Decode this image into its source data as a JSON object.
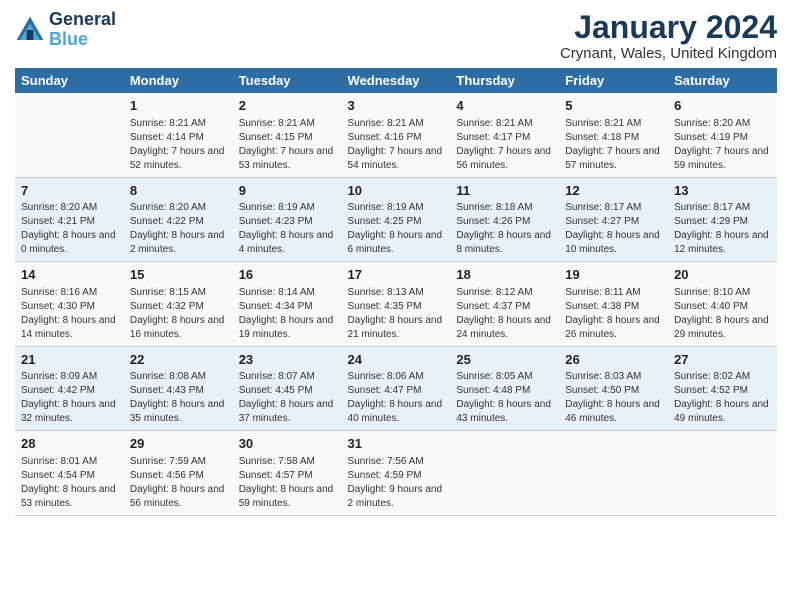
{
  "logo": {
    "line1": "General",
    "line2": "Blue"
  },
  "title": "January 2024",
  "location": "Crynant, Wales, United Kingdom",
  "days_of_week": [
    "Sunday",
    "Monday",
    "Tuesday",
    "Wednesday",
    "Thursday",
    "Friday",
    "Saturday"
  ],
  "weeks": [
    [
      {
        "num": "",
        "sunrise": "",
        "sunset": "",
        "daylight": ""
      },
      {
        "num": "1",
        "sunrise": "Sunrise: 8:21 AM",
        "sunset": "Sunset: 4:14 PM",
        "daylight": "Daylight: 7 hours and 52 minutes."
      },
      {
        "num": "2",
        "sunrise": "Sunrise: 8:21 AM",
        "sunset": "Sunset: 4:15 PM",
        "daylight": "Daylight: 7 hours and 53 minutes."
      },
      {
        "num": "3",
        "sunrise": "Sunrise: 8:21 AM",
        "sunset": "Sunset: 4:16 PM",
        "daylight": "Daylight: 7 hours and 54 minutes."
      },
      {
        "num": "4",
        "sunrise": "Sunrise: 8:21 AM",
        "sunset": "Sunset: 4:17 PM",
        "daylight": "Daylight: 7 hours and 56 minutes."
      },
      {
        "num": "5",
        "sunrise": "Sunrise: 8:21 AM",
        "sunset": "Sunset: 4:18 PM",
        "daylight": "Daylight: 7 hours and 57 minutes."
      },
      {
        "num": "6",
        "sunrise": "Sunrise: 8:20 AM",
        "sunset": "Sunset: 4:19 PM",
        "daylight": "Daylight: 7 hours and 59 minutes."
      }
    ],
    [
      {
        "num": "7",
        "sunrise": "Sunrise: 8:20 AM",
        "sunset": "Sunset: 4:21 PM",
        "daylight": "Daylight: 8 hours and 0 minutes."
      },
      {
        "num": "8",
        "sunrise": "Sunrise: 8:20 AM",
        "sunset": "Sunset: 4:22 PM",
        "daylight": "Daylight: 8 hours and 2 minutes."
      },
      {
        "num": "9",
        "sunrise": "Sunrise: 8:19 AM",
        "sunset": "Sunset: 4:23 PM",
        "daylight": "Daylight: 8 hours and 4 minutes."
      },
      {
        "num": "10",
        "sunrise": "Sunrise: 8:19 AM",
        "sunset": "Sunset: 4:25 PM",
        "daylight": "Daylight: 8 hours and 6 minutes."
      },
      {
        "num": "11",
        "sunrise": "Sunrise: 8:18 AM",
        "sunset": "Sunset: 4:26 PM",
        "daylight": "Daylight: 8 hours and 8 minutes."
      },
      {
        "num": "12",
        "sunrise": "Sunrise: 8:17 AM",
        "sunset": "Sunset: 4:27 PM",
        "daylight": "Daylight: 8 hours and 10 minutes."
      },
      {
        "num": "13",
        "sunrise": "Sunrise: 8:17 AM",
        "sunset": "Sunset: 4:29 PM",
        "daylight": "Daylight: 8 hours and 12 minutes."
      }
    ],
    [
      {
        "num": "14",
        "sunrise": "Sunrise: 8:16 AM",
        "sunset": "Sunset: 4:30 PM",
        "daylight": "Daylight: 8 hours and 14 minutes."
      },
      {
        "num": "15",
        "sunrise": "Sunrise: 8:15 AM",
        "sunset": "Sunset: 4:32 PM",
        "daylight": "Daylight: 8 hours and 16 minutes."
      },
      {
        "num": "16",
        "sunrise": "Sunrise: 8:14 AM",
        "sunset": "Sunset: 4:34 PM",
        "daylight": "Daylight: 8 hours and 19 minutes."
      },
      {
        "num": "17",
        "sunrise": "Sunrise: 8:13 AM",
        "sunset": "Sunset: 4:35 PM",
        "daylight": "Daylight: 8 hours and 21 minutes."
      },
      {
        "num": "18",
        "sunrise": "Sunrise: 8:12 AM",
        "sunset": "Sunset: 4:37 PM",
        "daylight": "Daylight: 8 hours and 24 minutes."
      },
      {
        "num": "19",
        "sunrise": "Sunrise: 8:11 AM",
        "sunset": "Sunset: 4:38 PM",
        "daylight": "Daylight: 8 hours and 26 minutes."
      },
      {
        "num": "20",
        "sunrise": "Sunrise: 8:10 AM",
        "sunset": "Sunset: 4:40 PM",
        "daylight": "Daylight: 8 hours and 29 minutes."
      }
    ],
    [
      {
        "num": "21",
        "sunrise": "Sunrise: 8:09 AM",
        "sunset": "Sunset: 4:42 PM",
        "daylight": "Daylight: 8 hours and 32 minutes."
      },
      {
        "num": "22",
        "sunrise": "Sunrise: 8:08 AM",
        "sunset": "Sunset: 4:43 PM",
        "daylight": "Daylight: 8 hours and 35 minutes."
      },
      {
        "num": "23",
        "sunrise": "Sunrise: 8:07 AM",
        "sunset": "Sunset: 4:45 PM",
        "daylight": "Daylight: 8 hours and 37 minutes."
      },
      {
        "num": "24",
        "sunrise": "Sunrise: 8:06 AM",
        "sunset": "Sunset: 4:47 PM",
        "daylight": "Daylight: 8 hours and 40 minutes."
      },
      {
        "num": "25",
        "sunrise": "Sunrise: 8:05 AM",
        "sunset": "Sunset: 4:48 PM",
        "daylight": "Daylight: 8 hours and 43 minutes."
      },
      {
        "num": "26",
        "sunrise": "Sunrise: 8:03 AM",
        "sunset": "Sunset: 4:50 PM",
        "daylight": "Daylight: 8 hours and 46 minutes."
      },
      {
        "num": "27",
        "sunrise": "Sunrise: 8:02 AM",
        "sunset": "Sunset: 4:52 PM",
        "daylight": "Daylight: 8 hours and 49 minutes."
      }
    ],
    [
      {
        "num": "28",
        "sunrise": "Sunrise: 8:01 AM",
        "sunset": "Sunset: 4:54 PM",
        "daylight": "Daylight: 8 hours and 53 minutes."
      },
      {
        "num": "29",
        "sunrise": "Sunrise: 7:59 AM",
        "sunset": "Sunset: 4:56 PM",
        "daylight": "Daylight: 8 hours and 56 minutes."
      },
      {
        "num": "30",
        "sunrise": "Sunrise: 7:58 AM",
        "sunset": "Sunset: 4:57 PM",
        "daylight": "Daylight: 8 hours and 59 minutes."
      },
      {
        "num": "31",
        "sunrise": "Sunrise: 7:56 AM",
        "sunset": "Sunset: 4:59 PM",
        "daylight": "Daylight: 9 hours and 2 minutes."
      },
      {
        "num": "",
        "sunrise": "",
        "sunset": "",
        "daylight": ""
      },
      {
        "num": "",
        "sunrise": "",
        "sunset": "",
        "daylight": ""
      },
      {
        "num": "",
        "sunrise": "",
        "sunset": "",
        "daylight": ""
      }
    ]
  ]
}
